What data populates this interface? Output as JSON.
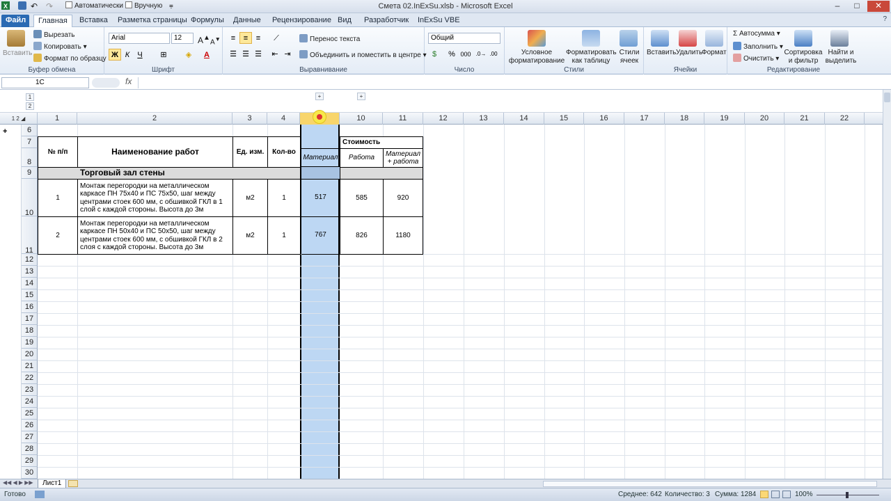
{
  "titlebar": {
    "title": "Смета 02.InExSu.xlsb - Microsoft Excel",
    "auto_calc": "Автоматически",
    "manual_calc": "Вручную",
    "minimize": "–",
    "maximize": "□",
    "close": "✕"
  },
  "tabs": [
    "Файл",
    "Главная",
    "Вставка",
    "Разметка страницы",
    "Формулы",
    "Данные",
    "Рецензирование",
    "Вид",
    "Разработчик",
    "InExSu VBE"
  ],
  "ribbon": {
    "clipboard": {
      "paste": "Вставить",
      "cut": "Вырезать",
      "copy": "Копировать",
      "format_painter": "Формат по образцу",
      "label": "Буфер обмена"
    },
    "font": {
      "name": "Arial",
      "size": "12",
      "bold": "Ж",
      "italic": "К",
      "underline": "Ч",
      "label": "Шрифт"
    },
    "alignment": {
      "wrap": "Перенос текста",
      "merge": "Объединить и поместить в центре",
      "label": "Выравнивание"
    },
    "number": {
      "format": "Общий",
      "label": "Число"
    },
    "styles": {
      "conditional": "Условное форматирование",
      "as_table": "Форматировать как таблицу",
      "cell_styles": "Стили ячеек",
      "label": "Стили"
    },
    "cells": {
      "insert": "Вставить",
      "delete": "Удалить",
      "format": "Формат",
      "label": "Ячейки"
    },
    "editing": {
      "autosum": "Автосумма",
      "fill": "Заполнить",
      "clear": "Очистить",
      "sort": "Сортировка и фильтр",
      "find": "Найти и выделить",
      "label": "Редактирование"
    }
  },
  "formula_bar": {
    "name_box": "1C",
    "fx": "fx",
    "value": ""
  },
  "outline": {
    "levels": [
      "1",
      "2"
    ]
  },
  "columns": [
    "1",
    "2",
    "3",
    "4",
    "9",
    "10",
    "11",
    "12",
    "13",
    "14",
    "15",
    "16",
    "17",
    "18",
    "19",
    "20",
    "21",
    "22"
  ],
  "rows": [
    "6",
    "7",
    "8",
    "9",
    "10",
    "11",
    "12",
    "13",
    "14",
    "15",
    "16",
    "17",
    "18",
    "19",
    "20",
    "21",
    "22",
    "23",
    "24",
    "25",
    "26",
    "27",
    "28",
    "29",
    "30"
  ],
  "table": {
    "h_num": "№ п/п",
    "h_name": "Наименование работ",
    "h_unit": "Ед. изм.",
    "h_qty": "Кол-во",
    "h_cost": "Стоимость",
    "h_material": "Материал",
    "h_work": "Работа",
    "h_total": "Материал + работа",
    "section": "Торговый зал стены",
    "rows": [
      {
        "num": "1",
        "name": "Монтаж перегородки на металлическом каркасе ПН 75х40 и ПС 75х50, шаг между центрами стоек 600 мм, с обшивкой ГКЛ в 1 слой с каждой стороны. Высота до 3м",
        "unit": "м2",
        "qty": "1",
        "material": "517",
        "work": "585",
        "total": "920"
      },
      {
        "num": "2",
        "name": "Монтаж перегородки на металлическом каркасе ПН 50х40 и ПС 50х50, шаг между центрами стоек 600 мм, с обшивкой ГКЛ в 2 слоя с каждой стороны. Высота до 3м",
        "unit": "м2",
        "qty": "1",
        "material": "767",
        "work": "826",
        "total": "1180"
      }
    ]
  },
  "sheet_tab": "Лист1",
  "status": {
    "ready": "Готово",
    "average": "Среднее: 642",
    "count": "Количество: 3",
    "sum": "Сумма: 1284",
    "zoom": "100%"
  },
  "colors": {
    "accent": "#2a6ab3",
    "selection": "#bdd7f3",
    "highlight": "#f8d56b"
  }
}
